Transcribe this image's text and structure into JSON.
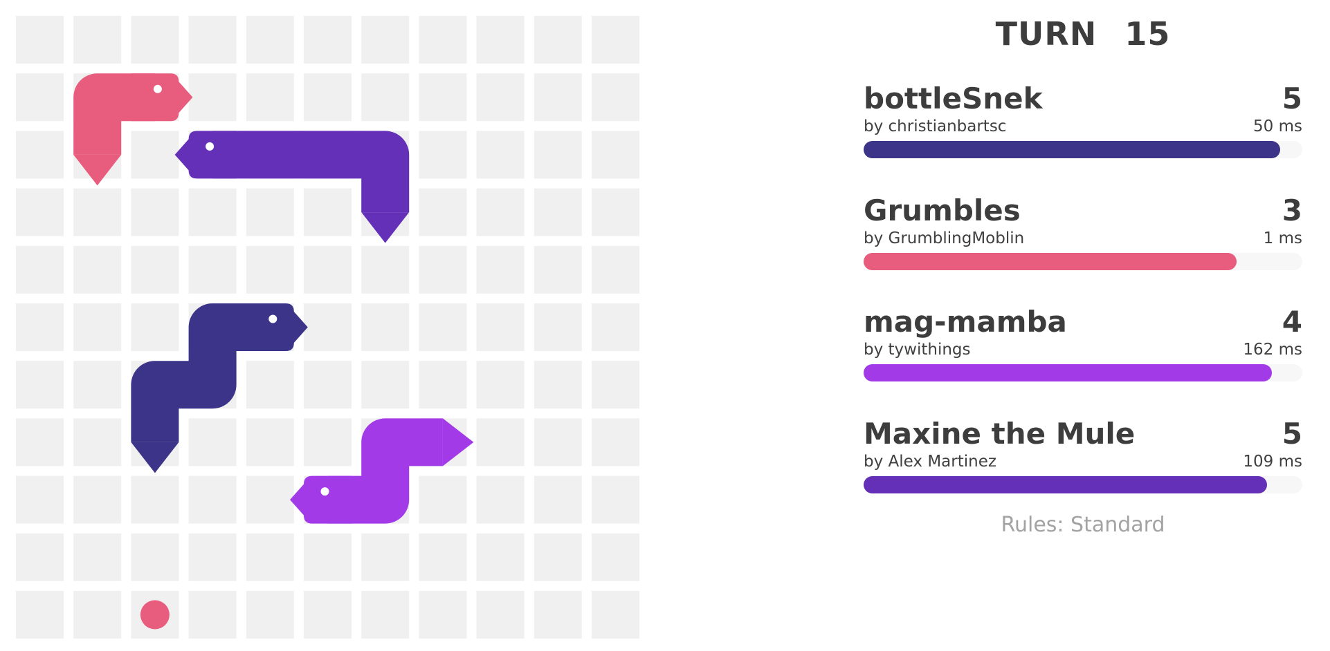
{
  "turn": {
    "label": "TURN",
    "value": "15"
  },
  "board": {
    "cells": 11,
    "cell_color": "#f0f0f0",
    "food": [
      {
        "col": 2,
        "row": 10,
        "color": "#e85c7d"
      }
    ],
    "snakes": [
      {
        "id": "grumbles",
        "color": "#e85c7d",
        "head_icon": "dino-head-icon",
        "tail_icon": "pointed-tail-icon",
        "body": [
          [
            2,
            1
          ],
          [
            1,
            1
          ],
          [
            1,
            2
          ]
        ]
      },
      {
        "id": "maxine",
        "color": "#6530b8",
        "head_icon": "chameleon-head-icon",
        "tail_icon": "rocket-tail-icon",
        "body": [
          [
            3,
            2
          ],
          [
            4,
            2
          ],
          [
            5,
            2
          ],
          [
            6,
            2
          ],
          [
            6,
            3
          ]
        ]
      },
      {
        "id": "bottlesnek",
        "color": "#3c3489",
        "head_icon": "beak-head-icon",
        "tail_icon": "elephant-trunk-tail-icon",
        "body": [
          [
            4,
            5
          ],
          [
            3,
            5
          ],
          [
            3,
            6
          ],
          [
            2,
            6
          ],
          [
            2,
            7
          ]
        ]
      },
      {
        "id": "mag-mamba",
        "color": "#a33ae8",
        "head_icon": "orca-head-icon",
        "tail_icon": "crown-tail-icon",
        "body": [
          [
            5,
            8
          ],
          [
            6,
            8
          ],
          [
            6,
            7
          ],
          [
            7,
            7
          ]
        ]
      }
    ]
  },
  "scoreboard": [
    {
      "name": "bottleSnek",
      "author": "by christianbartsc",
      "length": "5",
      "latency": "50 ms",
      "color": "#3c3489",
      "health": 0.95
    },
    {
      "name": "Grumbles",
      "author": "by GrumblingMoblin",
      "length": "3",
      "latency": "1 ms",
      "color": "#e85c7d",
      "health": 0.85
    },
    {
      "name": "mag-mamba",
      "author": "by tywithings",
      "length": "4",
      "latency": "162 ms",
      "color": "#a33ae8",
      "health": 0.93
    },
    {
      "name": "Maxine the Mule",
      "author": "by Alex Martinez",
      "length": "5",
      "latency": "109 ms",
      "color": "#6530b8",
      "health": 0.92
    }
  ],
  "rules": "Rules: Standard"
}
